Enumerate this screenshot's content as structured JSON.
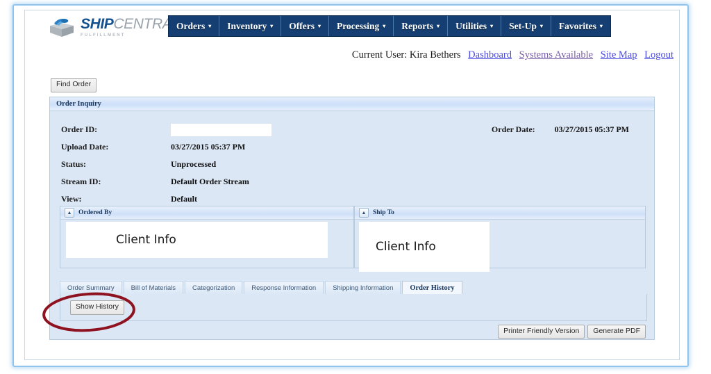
{
  "brand": {
    "logo_icon": "package-box-icon",
    "name_primary": "SHIP",
    "name_secondary": "CENTRAL",
    "tagline": "FULFILLMENT",
    "primary_color": "#14528f",
    "nav_color": "#153f72"
  },
  "nav": {
    "items": [
      {
        "label": "Orders",
        "caret": "▾"
      },
      {
        "label": "Inventory",
        "caret": "▾"
      },
      {
        "label": "Offers",
        "caret": "▾"
      },
      {
        "label": "Processing",
        "caret": "▾"
      },
      {
        "label": "Reports",
        "caret": "▾"
      },
      {
        "label": "Utilities",
        "caret": "▾"
      },
      {
        "label": "Set-Up",
        "caret": "▾"
      },
      {
        "label": "Favorites",
        "caret": "▾"
      }
    ]
  },
  "userbar": {
    "current_user_label": "Current User: Kira Bethers",
    "links": [
      {
        "label": "Dashboard"
      },
      {
        "label": "Systems Available"
      },
      {
        "label": "Site Map"
      },
      {
        "label": "Logout"
      }
    ]
  },
  "toolbar": {
    "find_order_label": "Find Order"
  },
  "order_inquiry": {
    "panel_title": "Order Inquiry",
    "fields": [
      {
        "label": "Order ID:",
        "value": ""
      },
      {
        "label": "Upload Date:",
        "value": "03/27/2015 05:37 PM"
      },
      {
        "label": "Status:",
        "value": "Unprocessed"
      },
      {
        "label": "Stream ID:",
        "value": "Default Order Stream"
      },
      {
        "label": "View:",
        "value": "Default"
      }
    ],
    "order_date": {
      "label": "Order Date:",
      "value": "03/27/2015 05:37 PM"
    }
  },
  "subpanels": [
    {
      "title": "Ordered By",
      "collapse_glyph": "▲",
      "content": "Client Info"
    },
    {
      "title": "Ship To",
      "collapse_glyph": "▲",
      "content": "Client Info"
    }
  ],
  "tabs": [
    {
      "label": "Order Summary",
      "active": false
    },
    {
      "label": "Bill of Materials",
      "active": false
    },
    {
      "label": "Categorization",
      "active": false
    },
    {
      "label": "Response Information",
      "active": false
    },
    {
      "label": "Shipping Information",
      "active": false
    },
    {
      "label": "Order History",
      "active": true
    }
  ],
  "tab_content": {
    "show_history_label": "Show History"
  },
  "footer": {
    "printer_friendly_label": "Printer Friendly Version",
    "generate_pdf_label": "Generate PDF"
  },
  "annotation": {
    "shape": "ellipse-highlight",
    "color": "#8e1220",
    "target": "Show History"
  }
}
